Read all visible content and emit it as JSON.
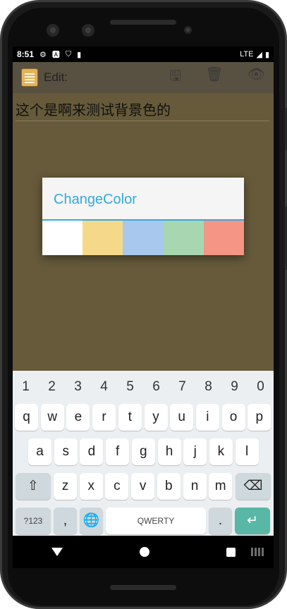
{
  "status_bar": {
    "time": "8:51",
    "network": "LTE",
    "icons": [
      "gear-icon",
      "a-icon",
      "shield-icon",
      "sd-card-icon",
      "signal-icon",
      "battery-icon"
    ]
  },
  "app_bar": {
    "title": "Edit:",
    "actions": [
      "save-icon",
      "trash-icon",
      "eye-icon"
    ]
  },
  "editor": {
    "text": "这个是啊来测试背景色的"
  },
  "dialog": {
    "title": "ChangeColor",
    "swatches": [
      {
        "name": "white",
        "color": "#ffffff"
      },
      {
        "name": "yellow",
        "color": "#f6d88a"
      },
      {
        "name": "blue",
        "color": "#a8c9ed"
      },
      {
        "name": "green",
        "color": "#a8d6b0"
      },
      {
        "name": "red",
        "color": "#f49585"
      }
    ]
  },
  "keyboard": {
    "numbers": [
      "1",
      "2",
      "3",
      "4",
      "5",
      "6",
      "7",
      "8",
      "9",
      "0"
    ],
    "row1": [
      "q",
      "w",
      "e",
      "r",
      "t",
      "y",
      "u",
      "i",
      "o",
      "p"
    ],
    "row2": [
      "a",
      "s",
      "d",
      "f",
      "g",
      "h",
      "j",
      "k",
      "l"
    ],
    "row3": [
      "z",
      "x",
      "c",
      "v",
      "b",
      "n",
      "m"
    ],
    "sym_label": "?123",
    "comma": ",",
    "space_label": "QWERTY",
    "period": "."
  }
}
